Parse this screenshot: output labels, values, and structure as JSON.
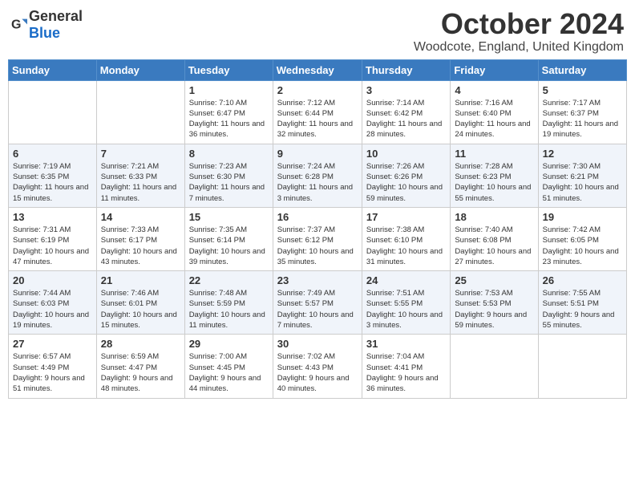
{
  "logo": {
    "general": "General",
    "blue": "Blue"
  },
  "header": {
    "month": "October 2024",
    "location": "Woodcote, England, United Kingdom"
  },
  "weekdays": [
    "Sunday",
    "Monday",
    "Tuesday",
    "Wednesday",
    "Thursday",
    "Friday",
    "Saturday"
  ],
  "weeks": [
    [
      {
        "day": "",
        "info": ""
      },
      {
        "day": "",
        "info": ""
      },
      {
        "day": "1",
        "info": "Sunrise: 7:10 AM\nSunset: 6:47 PM\nDaylight: 11 hours and 36 minutes."
      },
      {
        "day": "2",
        "info": "Sunrise: 7:12 AM\nSunset: 6:44 PM\nDaylight: 11 hours and 32 minutes."
      },
      {
        "day": "3",
        "info": "Sunrise: 7:14 AM\nSunset: 6:42 PM\nDaylight: 11 hours and 28 minutes."
      },
      {
        "day": "4",
        "info": "Sunrise: 7:16 AM\nSunset: 6:40 PM\nDaylight: 11 hours and 24 minutes."
      },
      {
        "day": "5",
        "info": "Sunrise: 7:17 AM\nSunset: 6:37 PM\nDaylight: 11 hours and 19 minutes."
      }
    ],
    [
      {
        "day": "6",
        "info": "Sunrise: 7:19 AM\nSunset: 6:35 PM\nDaylight: 11 hours and 15 minutes."
      },
      {
        "day": "7",
        "info": "Sunrise: 7:21 AM\nSunset: 6:33 PM\nDaylight: 11 hours and 11 minutes."
      },
      {
        "day": "8",
        "info": "Sunrise: 7:23 AM\nSunset: 6:30 PM\nDaylight: 11 hours and 7 minutes."
      },
      {
        "day": "9",
        "info": "Sunrise: 7:24 AM\nSunset: 6:28 PM\nDaylight: 11 hours and 3 minutes."
      },
      {
        "day": "10",
        "info": "Sunrise: 7:26 AM\nSunset: 6:26 PM\nDaylight: 10 hours and 59 minutes."
      },
      {
        "day": "11",
        "info": "Sunrise: 7:28 AM\nSunset: 6:23 PM\nDaylight: 10 hours and 55 minutes."
      },
      {
        "day": "12",
        "info": "Sunrise: 7:30 AM\nSunset: 6:21 PM\nDaylight: 10 hours and 51 minutes."
      }
    ],
    [
      {
        "day": "13",
        "info": "Sunrise: 7:31 AM\nSunset: 6:19 PM\nDaylight: 10 hours and 47 minutes."
      },
      {
        "day": "14",
        "info": "Sunrise: 7:33 AM\nSunset: 6:17 PM\nDaylight: 10 hours and 43 minutes."
      },
      {
        "day": "15",
        "info": "Sunrise: 7:35 AM\nSunset: 6:14 PM\nDaylight: 10 hours and 39 minutes."
      },
      {
        "day": "16",
        "info": "Sunrise: 7:37 AM\nSunset: 6:12 PM\nDaylight: 10 hours and 35 minutes."
      },
      {
        "day": "17",
        "info": "Sunrise: 7:38 AM\nSunset: 6:10 PM\nDaylight: 10 hours and 31 minutes."
      },
      {
        "day": "18",
        "info": "Sunrise: 7:40 AM\nSunset: 6:08 PM\nDaylight: 10 hours and 27 minutes."
      },
      {
        "day": "19",
        "info": "Sunrise: 7:42 AM\nSunset: 6:05 PM\nDaylight: 10 hours and 23 minutes."
      }
    ],
    [
      {
        "day": "20",
        "info": "Sunrise: 7:44 AM\nSunset: 6:03 PM\nDaylight: 10 hours and 19 minutes."
      },
      {
        "day": "21",
        "info": "Sunrise: 7:46 AM\nSunset: 6:01 PM\nDaylight: 10 hours and 15 minutes."
      },
      {
        "day": "22",
        "info": "Sunrise: 7:48 AM\nSunset: 5:59 PM\nDaylight: 10 hours and 11 minutes."
      },
      {
        "day": "23",
        "info": "Sunrise: 7:49 AM\nSunset: 5:57 PM\nDaylight: 10 hours and 7 minutes."
      },
      {
        "day": "24",
        "info": "Sunrise: 7:51 AM\nSunset: 5:55 PM\nDaylight: 10 hours and 3 minutes."
      },
      {
        "day": "25",
        "info": "Sunrise: 7:53 AM\nSunset: 5:53 PM\nDaylight: 9 hours and 59 minutes."
      },
      {
        "day": "26",
        "info": "Sunrise: 7:55 AM\nSunset: 5:51 PM\nDaylight: 9 hours and 55 minutes."
      }
    ],
    [
      {
        "day": "27",
        "info": "Sunrise: 6:57 AM\nSunset: 4:49 PM\nDaylight: 9 hours and 51 minutes."
      },
      {
        "day": "28",
        "info": "Sunrise: 6:59 AM\nSunset: 4:47 PM\nDaylight: 9 hours and 48 minutes."
      },
      {
        "day": "29",
        "info": "Sunrise: 7:00 AM\nSunset: 4:45 PM\nDaylight: 9 hours and 44 minutes."
      },
      {
        "day": "30",
        "info": "Sunrise: 7:02 AM\nSunset: 4:43 PM\nDaylight: 9 hours and 40 minutes."
      },
      {
        "day": "31",
        "info": "Sunrise: 7:04 AM\nSunset: 4:41 PM\nDaylight: 9 hours and 36 minutes."
      },
      {
        "day": "",
        "info": ""
      },
      {
        "day": "",
        "info": ""
      }
    ]
  ]
}
